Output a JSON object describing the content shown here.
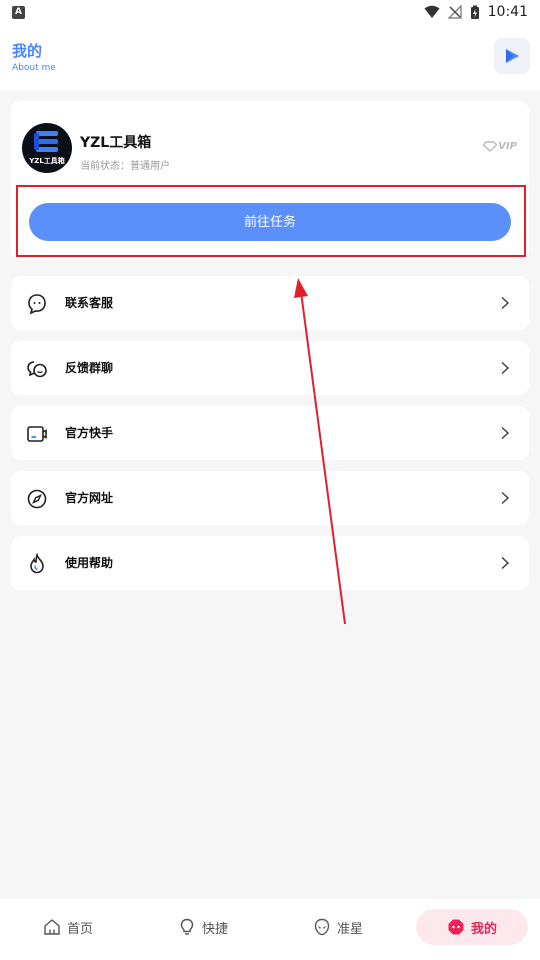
{
  "status_bar": {
    "left_badge": "A",
    "time": "10:41"
  },
  "header": {
    "title": "我的",
    "subtitle": "About me",
    "action_icon": "play-triangle-icon"
  },
  "profile": {
    "avatar_text": "YZL工具箱",
    "name": "YZL工具箱",
    "status_label": "当前状态：",
    "status_value": "普通用户",
    "vip_label": "VIP",
    "task_button_label": "前往任务"
  },
  "menu": [
    {
      "label": "联系客服",
      "icon": "customer-service-icon"
    },
    {
      "label": "反馈群聊",
      "icon": "group-chat-icon"
    },
    {
      "label": "官方快手",
      "icon": "kuaishou-icon"
    },
    {
      "label": "官方网址",
      "icon": "compass-icon"
    },
    {
      "label": "使用帮助",
      "icon": "help-fire-icon"
    }
  ],
  "bottom_nav": [
    {
      "label": "首页",
      "icon": "home-icon",
      "active": false
    },
    {
      "label": "快捷",
      "icon": "lightbulb-icon",
      "active": false
    },
    {
      "label": "准星",
      "icon": "alien-icon",
      "active": false
    },
    {
      "label": "我的",
      "icon": "profile-icon",
      "active": true
    }
  ],
  "colors": {
    "accent_blue": "#5b8ff9",
    "header_blue": "#4a86f7",
    "highlight_red": "#e0212b",
    "active_pink": "#e8245a",
    "active_pink_bg": "#fde8ee"
  }
}
